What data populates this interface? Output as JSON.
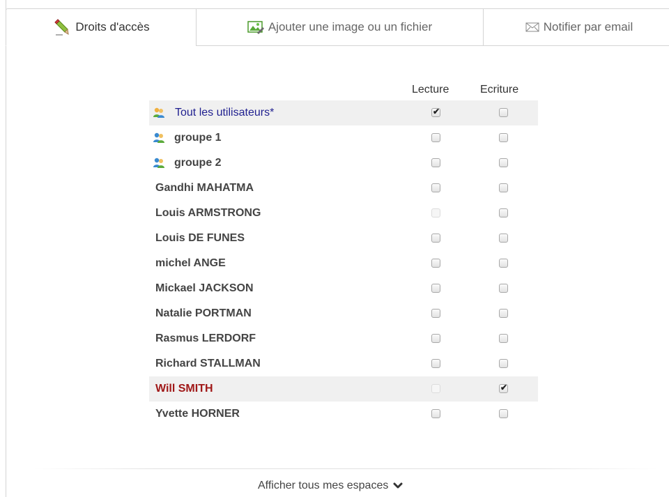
{
  "tabs": {
    "rights": {
      "label": "Droits d'accès",
      "icon": "pencil-icon"
    },
    "image": {
      "label": "Ajouter une image ou un fichier",
      "icon": "image-icon"
    },
    "notify": {
      "label": "Notifier par email",
      "icon": "envelope-icon"
    }
  },
  "table": {
    "col_read": "Lecture",
    "col_write": "Ecriture",
    "rows": [
      {
        "name": "Tout les utilisateurs*",
        "icon": "users-icon",
        "read": true,
        "write": false,
        "read_disabled": false
      },
      {
        "name": "groupe 1",
        "icon": "users-icon",
        "read": false,
        "write": false,
        "read_disabled": false
      },
      {
        "name": "groupe 2",
        "icon": "users-icon",
        "read": false,
        "write": false,
        "read_disabled": false
      },
      {
        "name": "Gandhi MAHATMA",
        "read": false,
        "write": false,
        "read_disabled": false
      },
      {
        "name": "Louis ARMSTRONG",
        "read": false,
        "write": false,
        "read_disabled": true
      },
      {
        "name": "Louis DE FUNES",
        "read": false,
        "write": false,
        "read_disabled": false
      },
      {
        "name": "michel ANGE",
        "read": false,
        "write": false,
        "read_disabled": false
      },
      {
        "name": "Mickael JACKSON",
        "read": false,
        "write": false,
        "read_disabled": false
      },
      {
        "name": "Natalie PORTMAN",
        "read": false,
        "write": false,
        "read_disabled": false
      },
      {
        "name": "Rasmus LERDORF",
        "read": false,
        "write": false,
        "read_disabled": false
      },
      {
        "name": "Richard STALLMAN",
        "read": false,
        "write": false,
        "read_disabled": false
      },
      {
        "name": "Will SMITH",
        "read": false,
        "write": true,
        "read_disabled": true
      },
      {
        "name": "Yvette HORNER",
        "read": false,
        "write": false,
        "read_disabled": false
      }
    ]
  },
  "footer": {
    "show_all_label": "Afficher tous mes espaces",
    "icon": "chevron-down-icon"
  },
  "colors": {
    "highlight_blue": "#1f1f8f",
    "highlight_red": "#a01818",
    "row_shade": "#f0f0f0"
  }
}
